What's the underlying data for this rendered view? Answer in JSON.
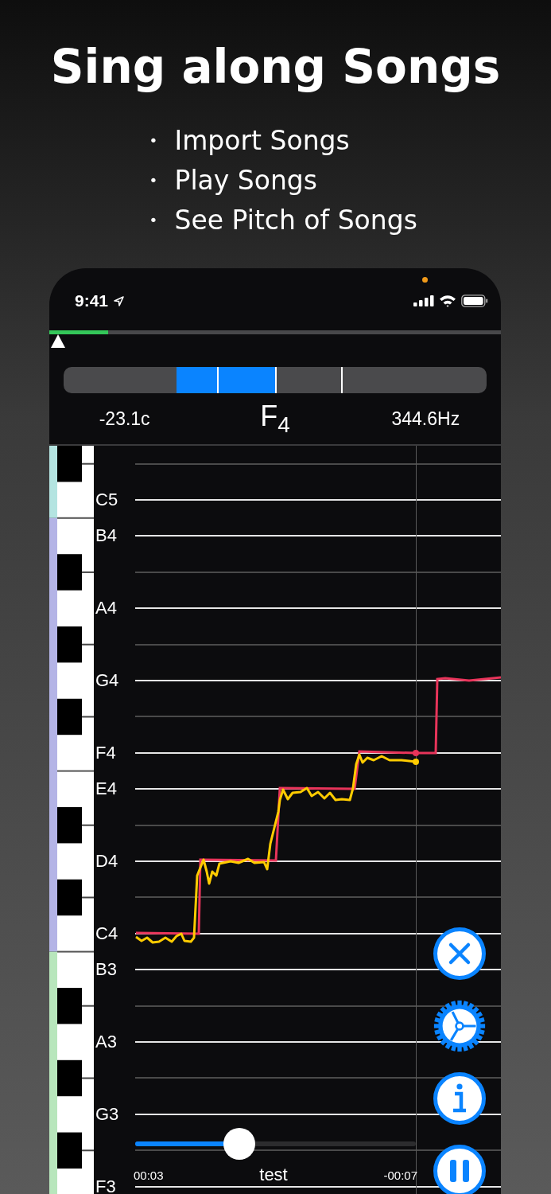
{
  "headline": "Sing along Songs",
  "features": [
    "・ Import Songs",
    "・ Play Songs",
    "・ See Pitch of Songs"
  ],
  "status_bar": {
    "time": "9:41"
  },
  "song_progress": {
    "level": 0.13
  },
  "tuner": {
    "cents": "-23.1c",
    "note": "F$_{4}$",
    "frequency": "344.6Hz"
  },
  "octaves": [
    {
      "color": "#b4e4e1",
      "keys": [
        {
          "kind": "sharp"
        },
        {
          "kind": "natural",
          "label": "C5"
        }
      ]
    },
    {
      "color": "#b4b4e6",
      "keys": [
        {
          "kind": "natural",
          "label": "B4"
        },
        {
          "kind": "sharp"
        },
        {
          "kind": "natural",
          "label": "A4"
        },
        {
          "kind": "sharp"
        },
        {
          "kind": "natural",
          "label": "G4"
        },
        {
          "kind": "sharp"
        },
        {
          "kind": "natural",
          "label": "F4"
        },
        {
          "kind": "natural",
          "label": "E4"
        },
        {
          "kind": "sharp"
        },
        {
          "kind": "natural",
          "label": "D4"
        },
        {
          "kind": "sharp"
        },
        {
          "kind": "natural",
          "label": "C4"
        }
      ]
    },
    {
      "color": "#b8e6bc",
      "keys": [
        {
          "kind": "natural",
          "label": "B3"
        },
        {
          "kind": "sharp"
        },
        {
          "kind": "natural",
          "label": "A3"
        },
        {
          "kind": "sharp"
        },
        {
          "kind": "natural",
          "label": "G3"
        },
        {
          "kind": "sharp"
        },
        {
          "kind": "natural",
          "label": "F3"
        }
      ]
    }
  ],
  "player": {
    "level": 0.37,
    "elapsed": "00:03",
    "title": "test",
    "remaining": "-00:07"
  },
  "buttons": [
    {
      "kind": "close"
    },
    {
      "kind": "settings"
    },
    {
      "kind": "info"
    },
    {
      "kind": "pause"
    }
  ]
}
